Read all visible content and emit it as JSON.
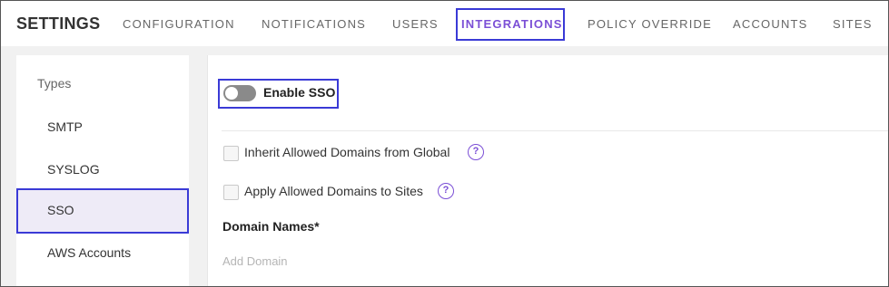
{
  "header": {
    "title": "SETTINGS",
    "tabs": [
      {
        "label": "CONFIGURATION",
        "active": false
      },
      {
        "label": "NOTIFICATIONS",
        "active": false
      },
      {
        "label": "USERS",
        "active": false
      },
      {
        "label": "INTEGRATIONS",
        "active": true
      },
      {
        "label": "POLICY OVERRIDE",
        "active": false
      },
      {
        "label": "ACCOUNTS",
        "active": false
      },
      {
        "label": "SITES",
        "active": false
      }
    ]
  },
  "sidebar": {
    "heading": "Types",
    "items": [
      {
        "label": "SMTP",
        "selected": false
      },
      {
        "label": "SYSLOG",
        "selected": false
      },
      {
        "label": "SSO",
        "selected": true
      },
      {
        "label": "AWS Accounts",
        "selected": false
      }
    ]
  },
  "main": {
    "enable_sso_label": "Enable SSO",
    "enable_sso_on": false,
    "inherit_domains_label": "Inherit Allowed Domains from Global",
    "apply_domains_label": "Apply Allowed Domains to Sites",
    "help_glyph": "?",
    "domain_names_title": "Domain Names*",
    "add_domain_placeholder": "Add Domain"
  },
  "colors": {
    "accent": "#7b4fd6",
    "highlight_border": "#3a3ad6",
    "selected_bg": "#eeebf7"
  }
}
